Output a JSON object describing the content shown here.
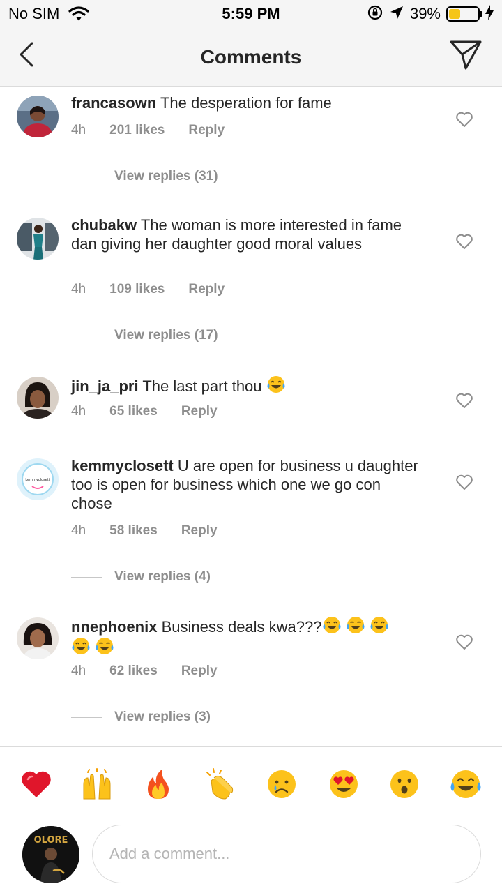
{
  "status_bar": {
    "carrier": "No SIM",
    "time": "5:59 PM",
    "battery_percent": "39%",
    "battery_level": 0.39
  },
  "header": {
    "title": "Comments",
    "back_icon": "chevron-left-icon",
    "send_icon": "paper-plane-icon"
  },
  "comments": [
    {
      "username": "francasown",
      "text": "The desperation for fame",
      "time": "4h",
      "likes": "201 likes",
      "reply": "Reply",
      "view_replies": "View replies (31)"
    },
    {
      "username": "chubakw",
      "text": "The woman is more interested in fame dan giving her daughter good moral values",
      "time": "4h",
      "likes": "109 likes",
      "reply": "Reply",
      "view_replies": "View replies (17)"
    },
    {
      "username": "jin_ja_pri",
      "text": "The last part thou",
      "time": "4h",
      "likes": "65 likes",
      "reply": "Reply"
    },
    {
      "username": "kemmyclosett",
      "text": "U are open for business u daughter too is open for business which one we go con chose",
      "time": "4h",
      "likes": "58 likes",
      "reply": "Reply",
      "view_replies": "View replies (4)",
      "avatar_text": "kemmyclosett"
    },
    {
      "username": "nnephoenix",
      "text": "Business deals kwa???",
      "time": "4h",
      "likes": "62 likes",
      "reply": "Reply",
      "view_replies": "View replies (3)"
    }
  ],
  "emoji_bar": [
    "red-heart",
    "raising-hands",
    "fire",
    "clapping-hands",
    "crying-face",
    "heart-eyes-face",
    "surprised-face",
    "tears-of-joy-face"
  ],
  "composer": {
    "placeholder": "Add a comment...",
    "avatar_text": "OLORE"
  },
  "colors": {
    "text": "#262626",
    "secondary": "#8e8e8e",
    "divider": "#dbdbdb",
    "battery": "#f5c518"
  }
}
